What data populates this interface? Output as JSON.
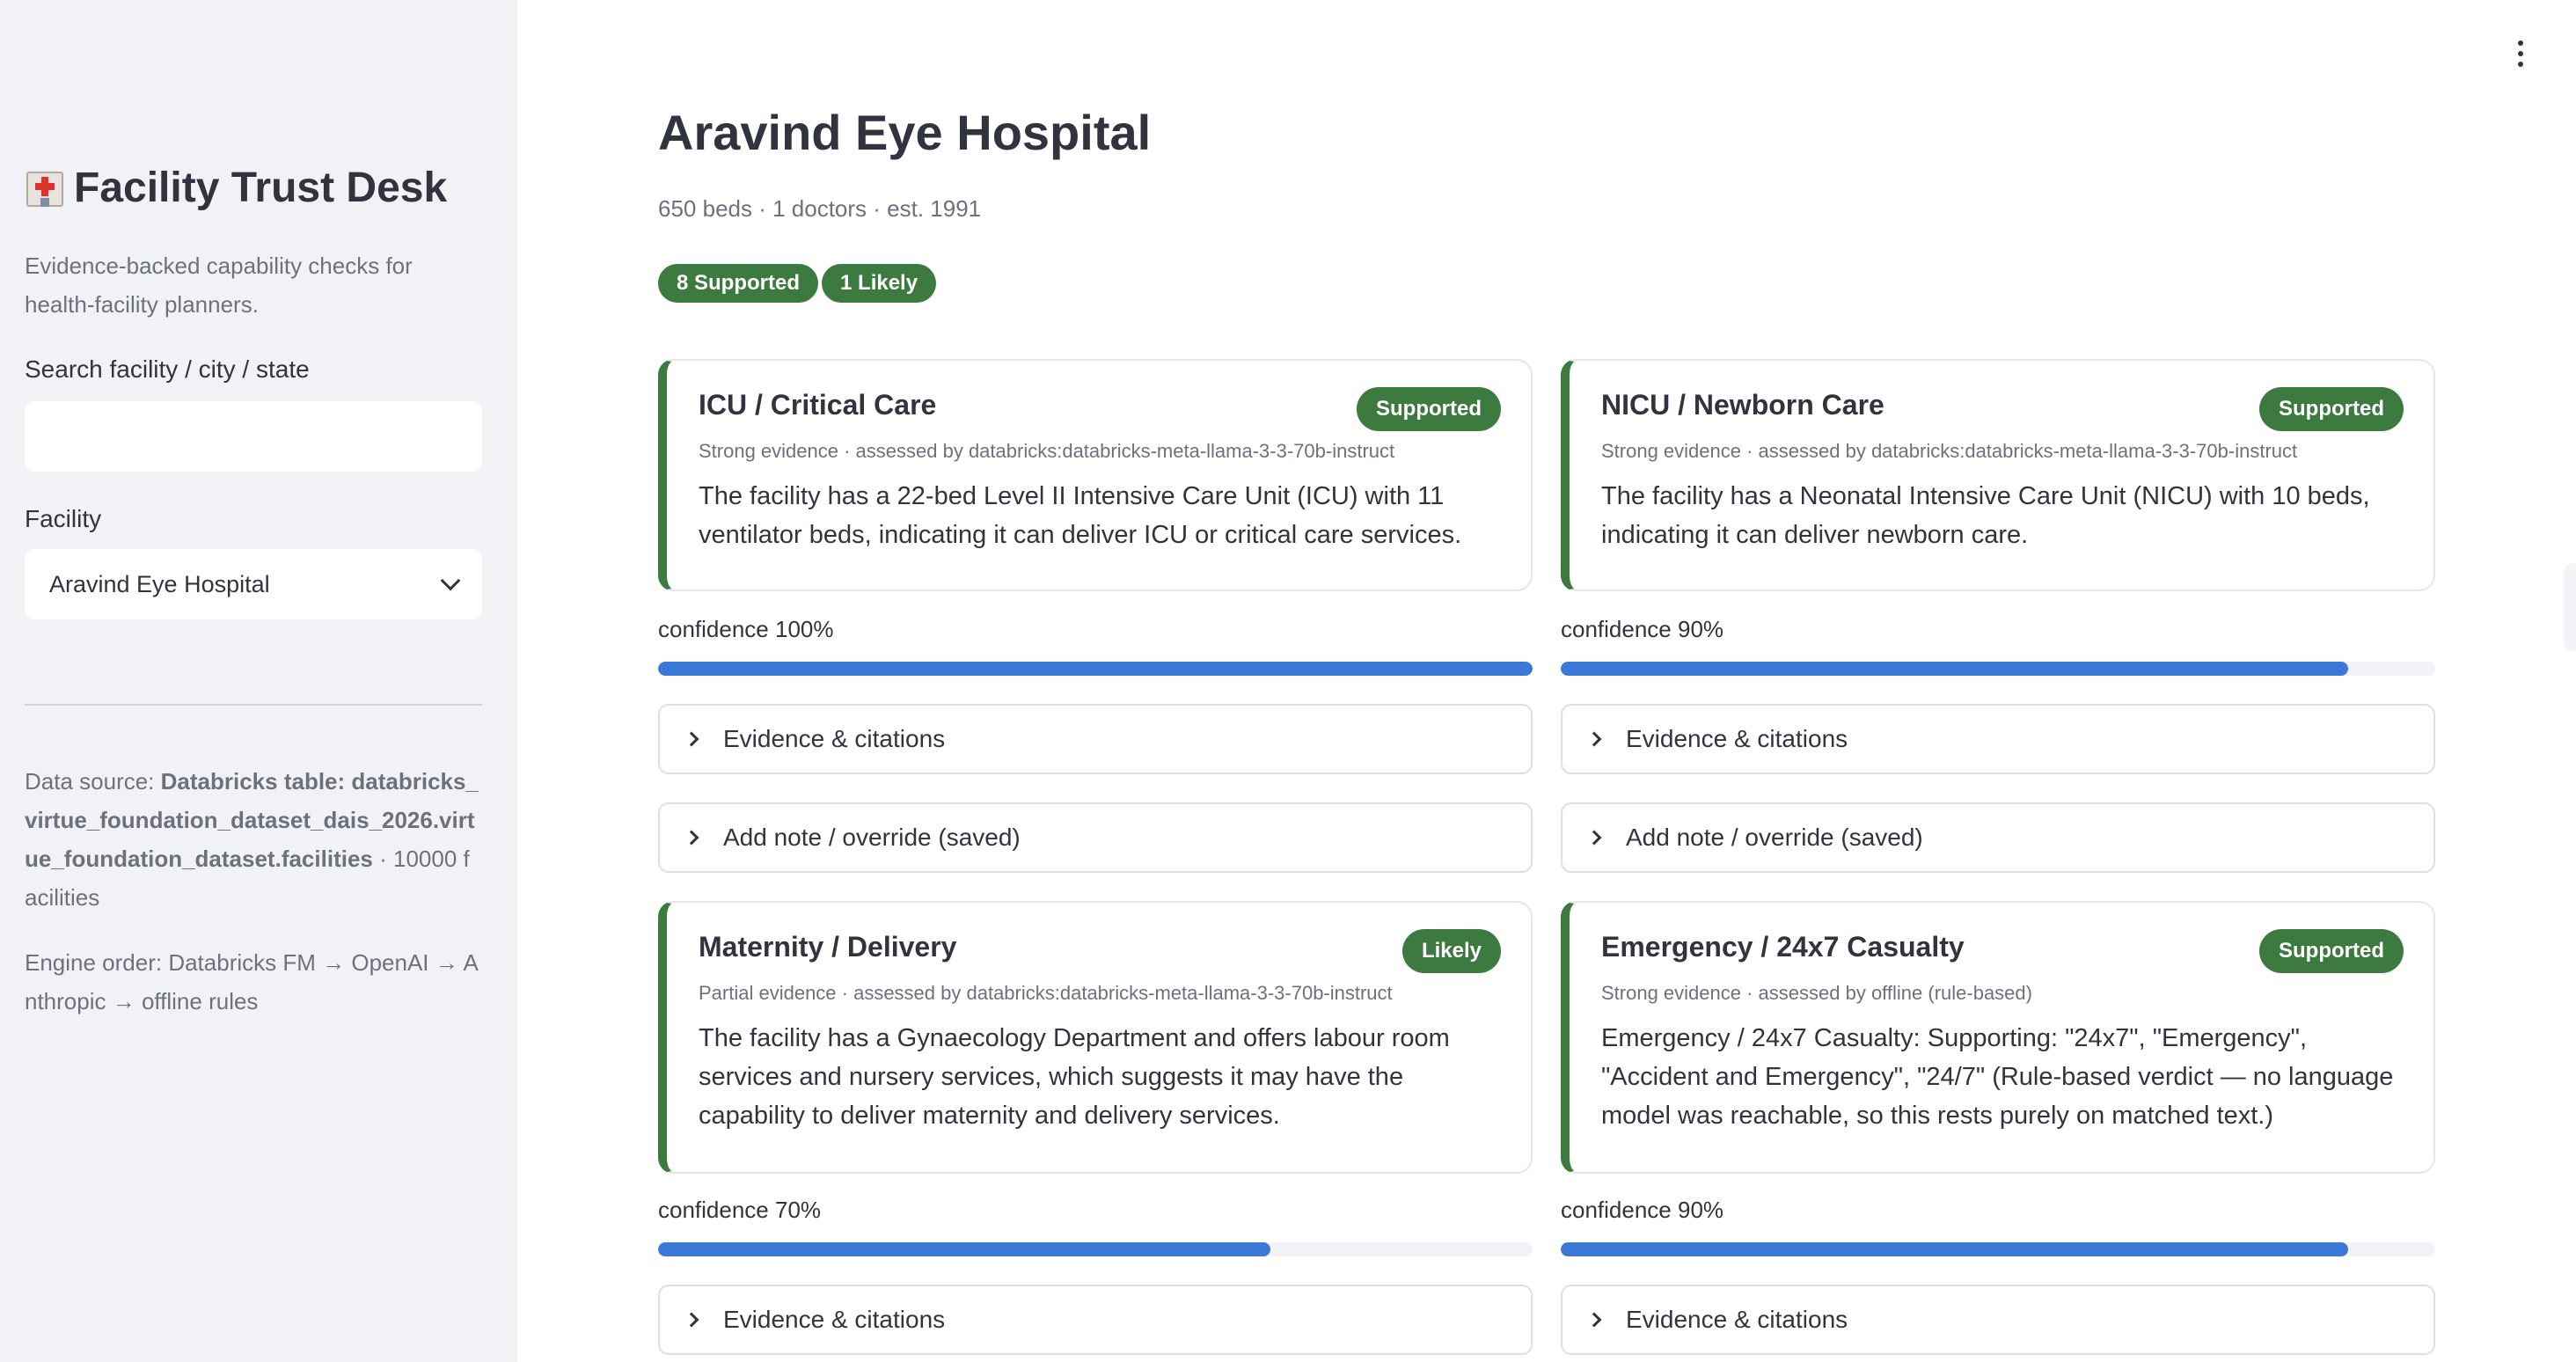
{
  "sidebar": {
    "title": "Facility Trust Desk",
    "subtitle": "Evidence-backed capability checks for health-facility planners.",
    "search_label": "Search facility / city / state",
    "search_value": "",
    "facility_label": "Facility",
    "facility_selected": "Aravind Eye Hospital",
    "data_source_prefix": "Data source: ",
    "data_source_table": "Databricks table: databricks_virtue_foundation_dataset_dais_2026.virtue_foundation_dataset.facilities",
    "data_source_suffix": " · 10000 facilities",
    "engine_order": "Engine order: Databricks FM → OpenAI → Anthropic → offline rules",
    "title_icon": "hospital-icon"
  },
  "main": {
    "title": "Aravind Eye Hospital",
    "subtitle": "650 beds · 1 doctors · est. 1991",
    "summary_badges": [
      "8 Supported",
      "1 Likely"
    ],
    "cards": [
      {
        "title": "ICU / Critical Care",
        "badge": "Supported",
        "meta": "Strong evidence · assessed by databricks:databricks-meta-llama-3-3-70b-instruct",
        "text": "The facility has a 22-bed Level II Intensive Care Unit (ICU) with 11 ventilator beds, indicating it can deliver ICU or critical care services.",
        "confidence_label": "confidence 100%",
        "confidence": 1.0,
        "evidence_label": "Evidence & citations",
        "note_label": "Add note / override (saved)"
      },
      {
        "title": "NICU / Newborn Care",
        "badge": "Supported",
        "meta": "Strong evidence · assessed by databricks:databricks-meta-llama-3-3-70b-instruct",
        "text": "The facility has a Neonatal Intensive Care Unit (NICU) with 10 beds, indicating it can deliver newborn care.",
        "confidence_label": "confidence 90%",
        "confidence": 0.9,
        "evidence_label": "Evidence & citations",
        "note_label": "Add note / override (saved)"
      },
      {
        "title": "Maternity / Delivery",
        "badge": "Likely",
        "meta": "Partial evidence · assessed by databricks:databricks-meta-llama-3-3-70b-instruct",
        "text": "The facility has a Gynaecology Department and offers labour room services and nursery services, which suggests it may have the capability to deliver maternity and delivery services.",
        "confidence_label": "confidence 70%",
        "confidence": 0.7,
        "evidence_label": "Evidence & citations"
      },
      {
        "title": "Emergency / 24x7 Casualty",
        "badge": "Supported",
        "meta": "Strong evidence · assessed by offline (rule-based)",
        "text": "Emergency / 24x7 Casualty: Supporting: \"24x7\", \"Emergency\", \"Accident and Emergency\", \"24/7\" (Rule-based verdict — no language model was reachable, so this rests purely on matched text.)",
        "confidence_label": "confidence 90%",
        "confidence": 0.9,
        "evidence_label": "Evidence & citations"
      }
    ]
  },
  "colors": {
    "sidebar_bg": "#f0f2f6",
    "badge_green": "#3d7a3f",
    "progress_blue": "#3b78d8",
    "text": "#31333f",
    "muted": "#6d717e"
  }
}
